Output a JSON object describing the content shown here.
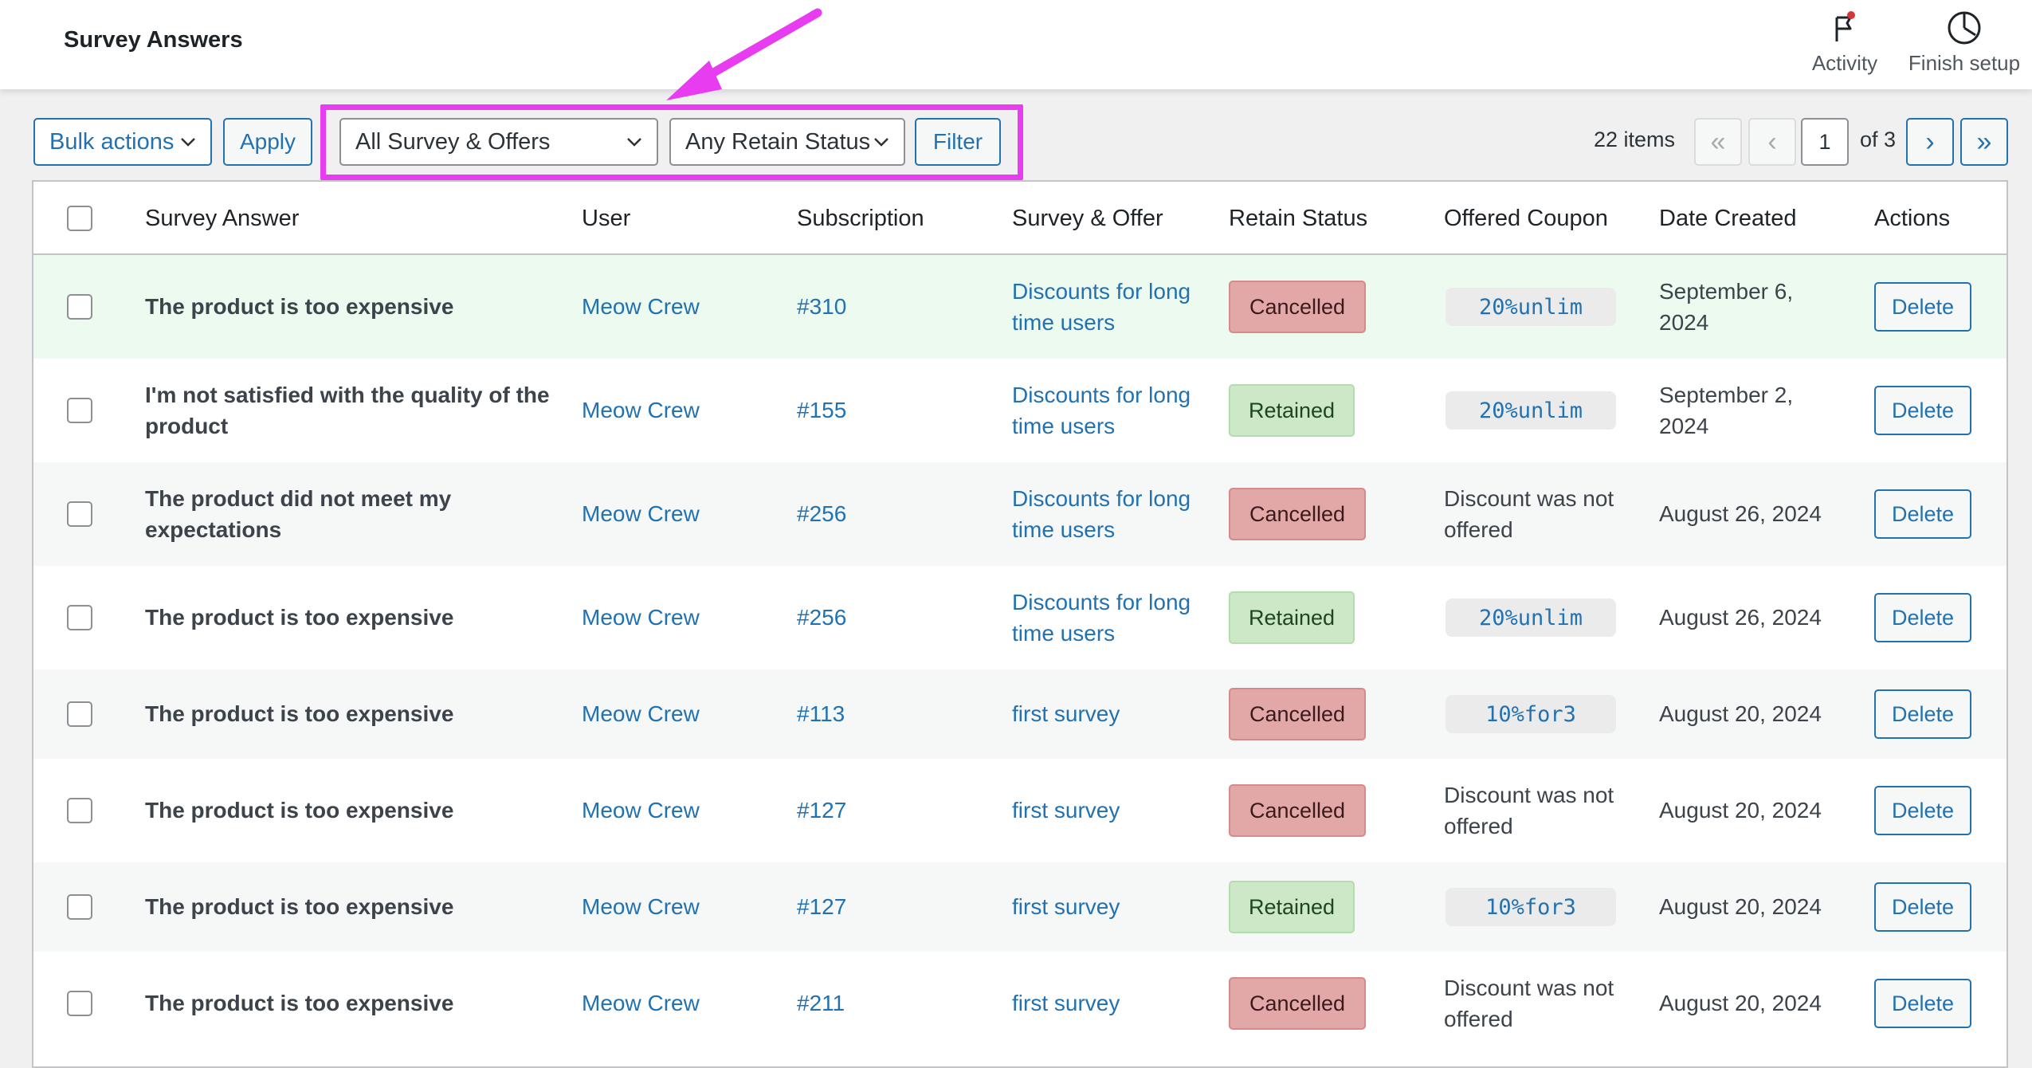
{
  "page": {
    "title": "Survey Answers"
  },
  "top_actions": [
    {
      "label": "Activity",
      "icon": "flag-notification-icon"
    },
    {
      "label": "Finish setup",
      "icon": "progress-circle-icon"
    }
  ],
  "toolbar": {
    "bulk_actions": "Bulk actions",
    "apply": "Apply",
    "survey_filter": "All Survey & Offers",
    "status_filter": "Any Retain Status",
    "filter": "Filter",
    "highlight_color": "#e83cf0"
  },
  "pagination": {
    "items": "22 items",
    "first": "«",
    "prev": "‹",
    "current": "1",
    "of_total": "of 3",
    "next": "›",
    "last": "»"
  },
  "columns": [
    "Survey Answer",
    "User",
    "Subscription",
    "Survey & Offer",
    "Retain Status",
    "Offered Coupon",
    "Date Created",
    "Actions"
  ],
  "rows": [
    {
      "answer": "The product is too expensive",
      "user": "Meow Crew",
      "subscription": "#310",
      "survey": "Discounts for long time users",
      "status": "Cancelled",
      "coupon": "20%unlim",
      "coupon_is_code": true,
      "date": "September 6, 2024",
      "action": "Delete"
    },
    {
      "answer": "I'm not satisfied with the quality of the product",
      "user": "Meow Crew",
      "subscription": "#155",
      "survey": "Discounts for long time users",
      "status": "Retained",
      "coupon": "20%unlim",
      "coupon_is_code": true,
      "date": "September 2, 2024",
      "action": "Delete"
    },
    {
      "answer": "The product did not meet my expectations",
      "user": "Meow Crew",
      "subscription": "#256",
      "survey": "Discounts for long time users",
      "status": "Cancelled",
      "coupon": "Discount was not offered",
      "coupon_is_code": false,
      "date": "August 26, 2024",
      "action": "Delete"
    },
    {
      "answer": "The product is too expensive",
      "user": "Meow Crew",
      "subscription": "#256",
      "survey": "Discounts for long time users",
      "status": "Retained",
      "coupon": "20%unlim",
      "coupon_is_code": true,
      "date": "August 26, 2024",
      "action": "Delete"
    },
    {
      "answer": "The product is too expensive",
      "user": "Meow Crew",
      "subscription": "#113",
      "survey": "first survey",
      "status": "Cancelled",
      "coupon": "10%for3",
      "coupon_is_code": true,
      "date": "August 20, 2024",
      "action": "Delete"
    },
    {
      "answer": "The product is too expensive",
      "user": "Meow Crew",
      "subscription": "#127",
      "survey": "first survey",
      "status": "Cancelled",
      "coupon": "Discount was not offered",
      "coupon_is_code": false,
      "date": "August 20, 2024",
      "action": "Delete"
    },
    {
      "answer": "The product is too expensive",
      "user": "Meow Crew",
      "subscription": "#127",
      "survey": "first survey",
      "status": "Retained",
      "coupon": "10%for3",
      "coupon_is_code": true,
      "date": "August 20, 2024",
      "action": "Delete"
    },
    {
      "answer": "The product is too expensive",
      "user": "Meow Crew",
      "subscription": "#211",
      "survey": "first survey",
      "status": "Cancelled",
      "coupon": "Discount was not offered",
      "coupon_is_code": false,
      "date": "August 20, 2024",
      "action": "Delete"
    }
  ],
  "colors": {
    "link": "#2271b1",
    "cancelled_bg": "#e2a8a8",
    "retained_bg": "#cce8c6",
    "highlighted_row_bg": "#edfaef"
  }
}
